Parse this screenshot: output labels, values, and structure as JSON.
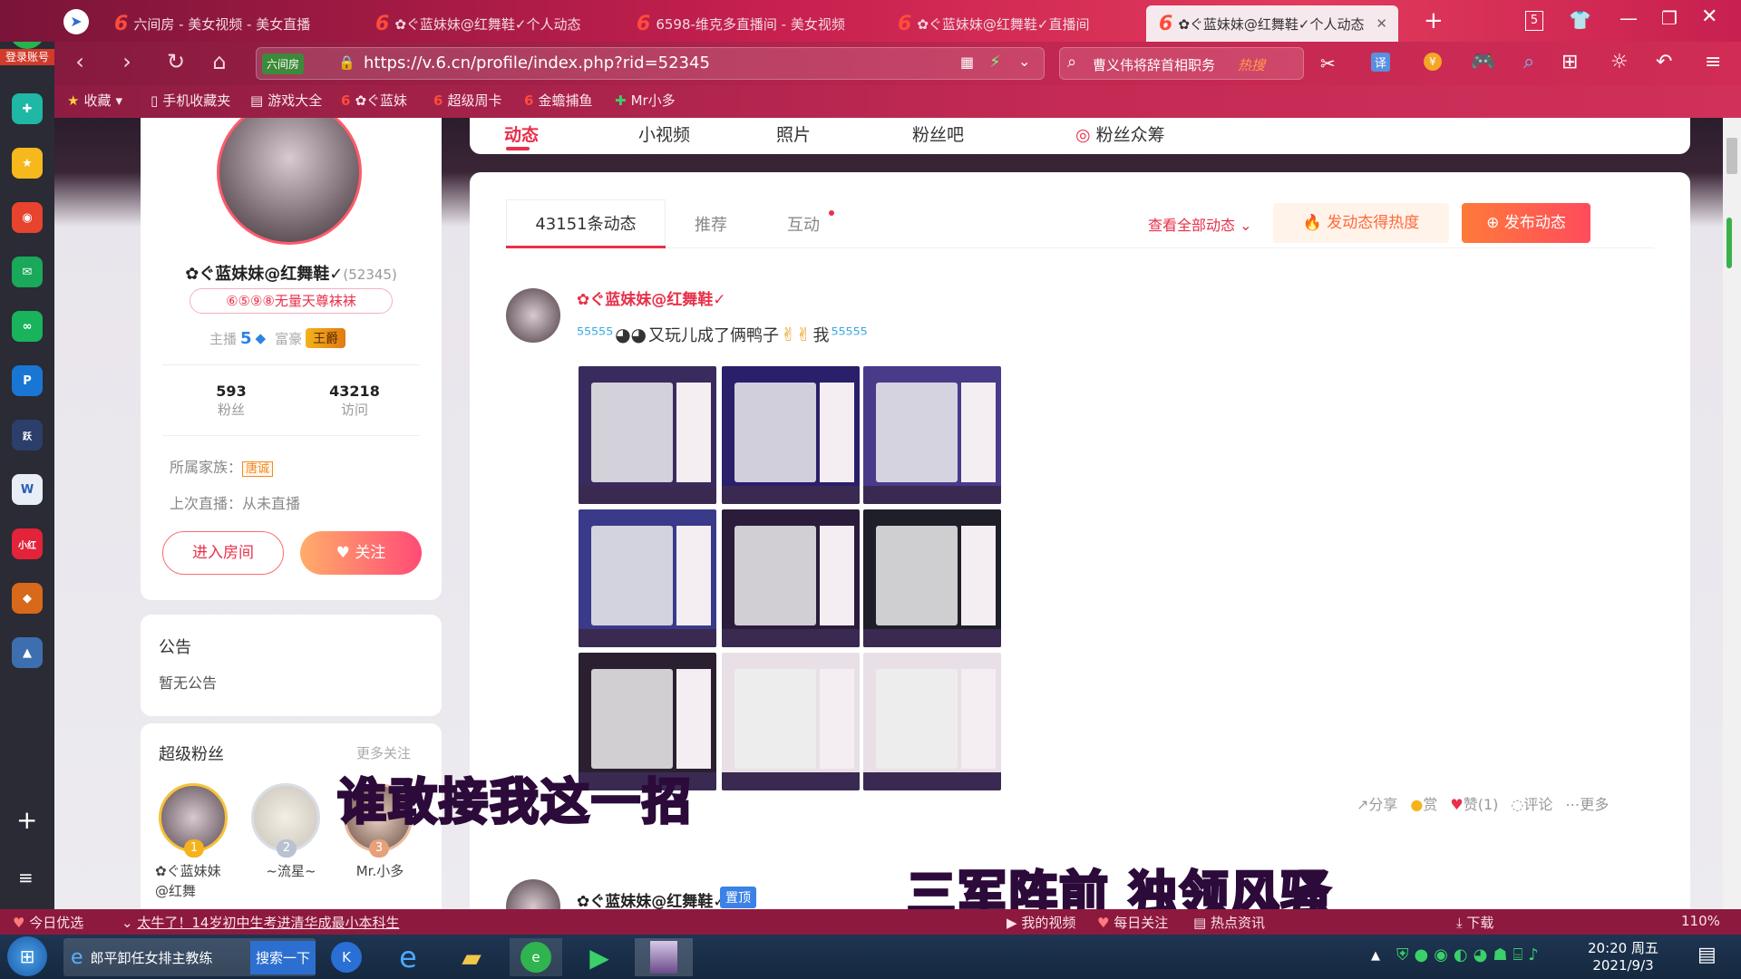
{
  "browser": {
    "tabs": [
      {
        "label": "六间房 - 美女视频 - 美女直播"
      },
      {
        "label": "✿ぐ蓝妹妹@红舞鞋✓个人动态"
      },
      {
        "label": "6598-维克多直播间 - 美女视频"
      },
      {
        "label": "✿ぐ蓝妹妹@红舞鞋✓直播间"
      },
      {
        "label": "✿ぐ蓝妹妹@红舞鞋✓个人动态",
        "active": true
      }
    ],
    "tab_count": "5",
    "url": "https://v.6.cn/profile/index.php?rid=52345",
    "site_badge": "六间房",
    "search_text": "曹义伟将辞首相职务",
    "search_hot": "热搜",
    "bookmarks": [
      "收藏",
      "手机收藏夹",
      "游戏大全",
      "✿ぐ蓝妹",
      "超级周卡",
      "金蟾捕鱼",
      "Mr小多"
    ],
    "login_label": "登录账号"
  },
  "profile": {
    "name": "✿ぐ蓝妹妹@红舞鞋✓",
    "rid": "(52345)",
    "badge": "⑥⑤⑨⑧无量天尊袜袜",
    "anchor_label": "主播",
    "anchor_level": "5",
    "rich_label": "富豪",
    "rich_title": "王爵",
    "fans_count": "593",
    "fans_label": "粉丝",
    "visits_count": "43218",
    "visits_label": "访问",
    "family_label": "所属家族：",
    "family_name": "唐诚",
    "last_live": "上次直播：从未直播",
    "enter_room": "进入房间",
    "follow": "关注"
  },
  "notice": {
    "title": "公告",
    "content": "暂无公告"
  },
  "super_fans": {
    "title": "超级粉丝",
    "more": "更多关注",
    "fans": [
      {
        "rank": "1",
        "name": "✿ぐ蓝妹妹@红舞"
      },
      {
        "rank": "2",
        "name": "~流星~"
      },
      {
        "rank": "3",
        "name": "Mr.小多"
      }
    ]
  },
  "profile_tabs": [
    "动态",
    "小视频",
    "照片",
    "粉丝吧",
    "粉丝众筹"
  ],
  "feed": {
    "tabs": [
      "43151条动态",
      "推荐",
      "互动"
    ],
    "view_all": "查看全部动态",
    "hot_btn": "发动态得热度",
    "publish_btn": "发布动态",
    "post": {
      "author": "✿ぐ蓝妹妹@红舞鞋✓",
      "text_mid": "又玩儿成了俩鸭子",
      "text_wo": "我",
      "actions": [
        "分享",
        "赏",
        "赞(1)",
        "评论",
        "更多"
      ]
    },
    "post2": {
      "author": "✿ぐ蓝妹妹@红舞鞋✓",
      "pin": "置顶"
    }
  },
  "overlays": {
    "line1": "谁敢接我这一招",
    "line2": "三军阵前  独领风骚"
  },
  "status": {
    "daily": "今日优选",
    "news": "太牛了！14岁初中生考进清华成最小本科生",
    "items": [
      "我的视频",
      "每日关注",
      "热点资讯",
      "下载"
    ],
    "zoom": "110%"
  },
  "taskbar": {
    "ie_title": "郎平卸任女排主教练",
    "search_btn": "搜索一下",
    "time": "20:20 周五",
    "date": "2021/9/3"
  },
  "colors": {
    "accent": "#e8304a",
    "orange": "#ff6a3c",
    "pink": "#ff6b8b"
  }
}
